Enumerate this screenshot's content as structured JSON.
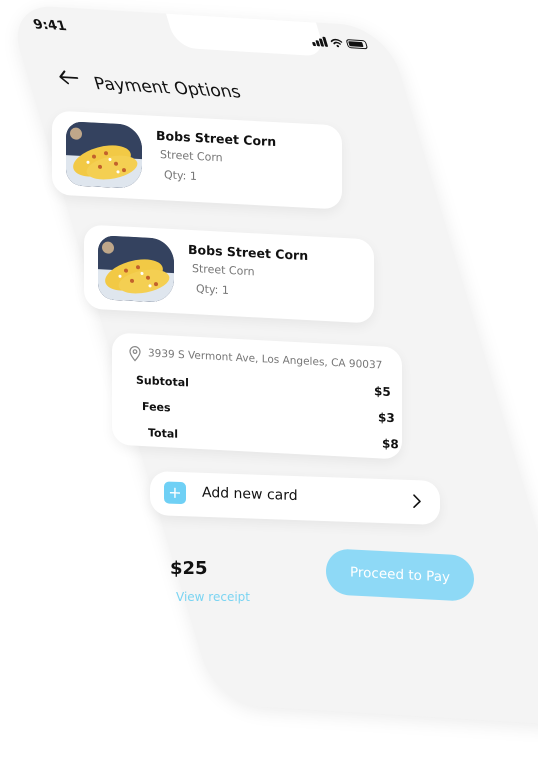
{
  "status_bar": {
    "time": "9:41"
  },
  "header": {
    "title": "Payment Options",
    "back_icon": "arrow-left-icon"
  },
  "order_items": [
    {
      "name": "Bobs Street Corn",
      "subtitle": "Street Corn",
      "qty": "Qty: 1"
    },
    {
      "name": "Bobs Street Corn",
      "subtitle": "Street Corn",
      "qty": "Qty: 1"
    }
  ],
  "summary": {
    "address": "3939 S Vermont Ave, Los Angeles, CA 90037",
    "subtotal_label": "Subtotal",
    "subtotal_value": "$5",
    "fees_label": "Fees",
    "fees_value": "$3",
    "total_label": "Total",
    "total_value": "$8"
  },
  "add_card": {
    "label": "Add new card",
    "icon": "plus-icon"
  },
  "footer": {
    "amount": "$25",
    "receipt_link": "View receipt",
    "proceed_label": "Proceed to Pay"
  },
  "colors": {
    "accent": "#8ed9f6",
    "link": "#7ad4f2",
    "background": "#f4f4f4",
    "card": "#ffffff"
  }
}
